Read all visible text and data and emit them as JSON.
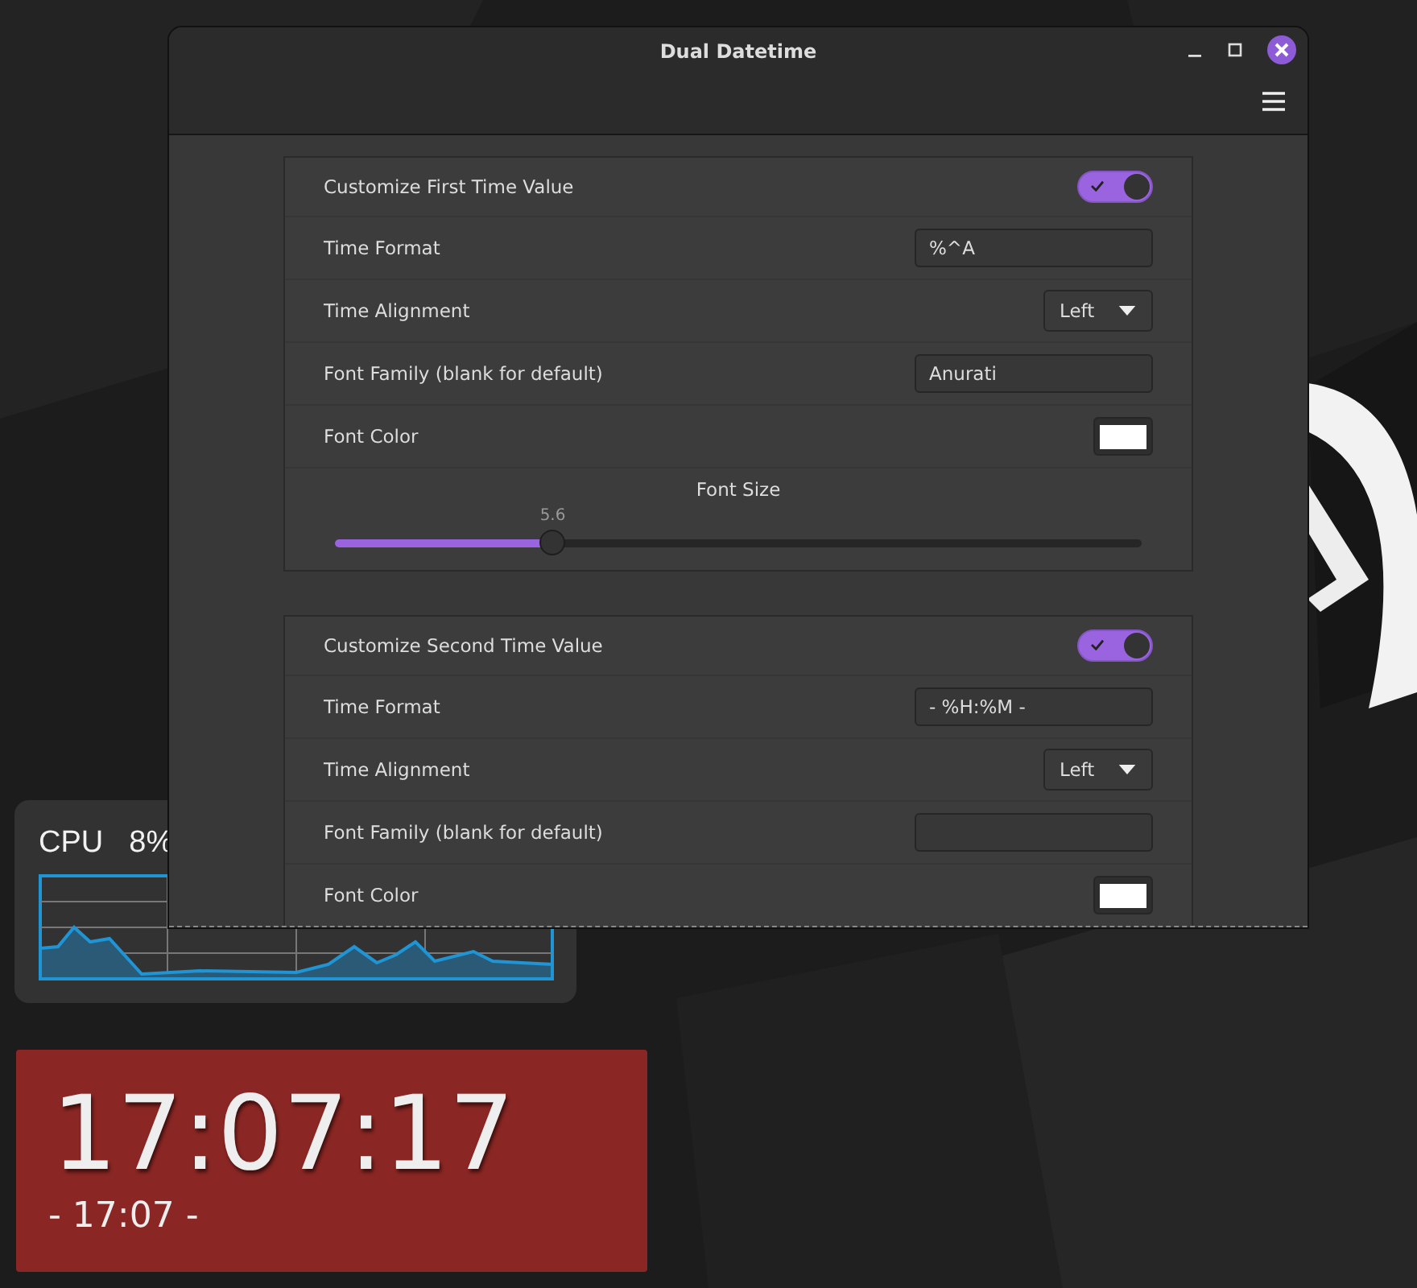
{
  "window": {
    "title": "Dual Datetime"
  },
  "sections": [
    {
      "rows": [
        {
          "kind": "switch",
          "label": "Customize First Time Value",
          "on": true
        },
        {
          "kind": "entry",
          "label": "Time Format",
          "value": "%^A"
        },
        {
          "kind": "dropdown",
          "label": "Time Alignment",
          "value": "Left"
        },
        {
          "kind": "entry",
          "label": "Font Family (blank for default)",
          "value": "Anurati"
        },
        {
          "kind": "color",
          "label": "Font Color",
          "color": "#ffffff"
        }
      ],
      "slider": {
        "label": "Font Size",
        "reading": "5.6",
        "level": 0.27
      }
    },
    {
      "rows": [
        {
          "kind": "switch",
          "label": "Customize Second Time Value",
          "on": true
        },
        {
          "kind": "entry",
          "label": "Time Format",
          "value": "- %H:%M -"
        },
        {
          "kind": "dropdown",
          "label": "Time Alignment",
          "value": "Left"
        },
        {
          "kind": "entry",
          "label": "Font Family (blank for default)"
        },
        {
          "kind": "color",
          "label": "Font Color",
          "color": "#ffffff"
        }
      ]
    }
  ],
  "cpu": {
    "label": "CPU",
    "value": "8%"
  },
  "clock": {
    "time": "17:07:17",
    "secondary": "- 17:07 -"
  }
}
